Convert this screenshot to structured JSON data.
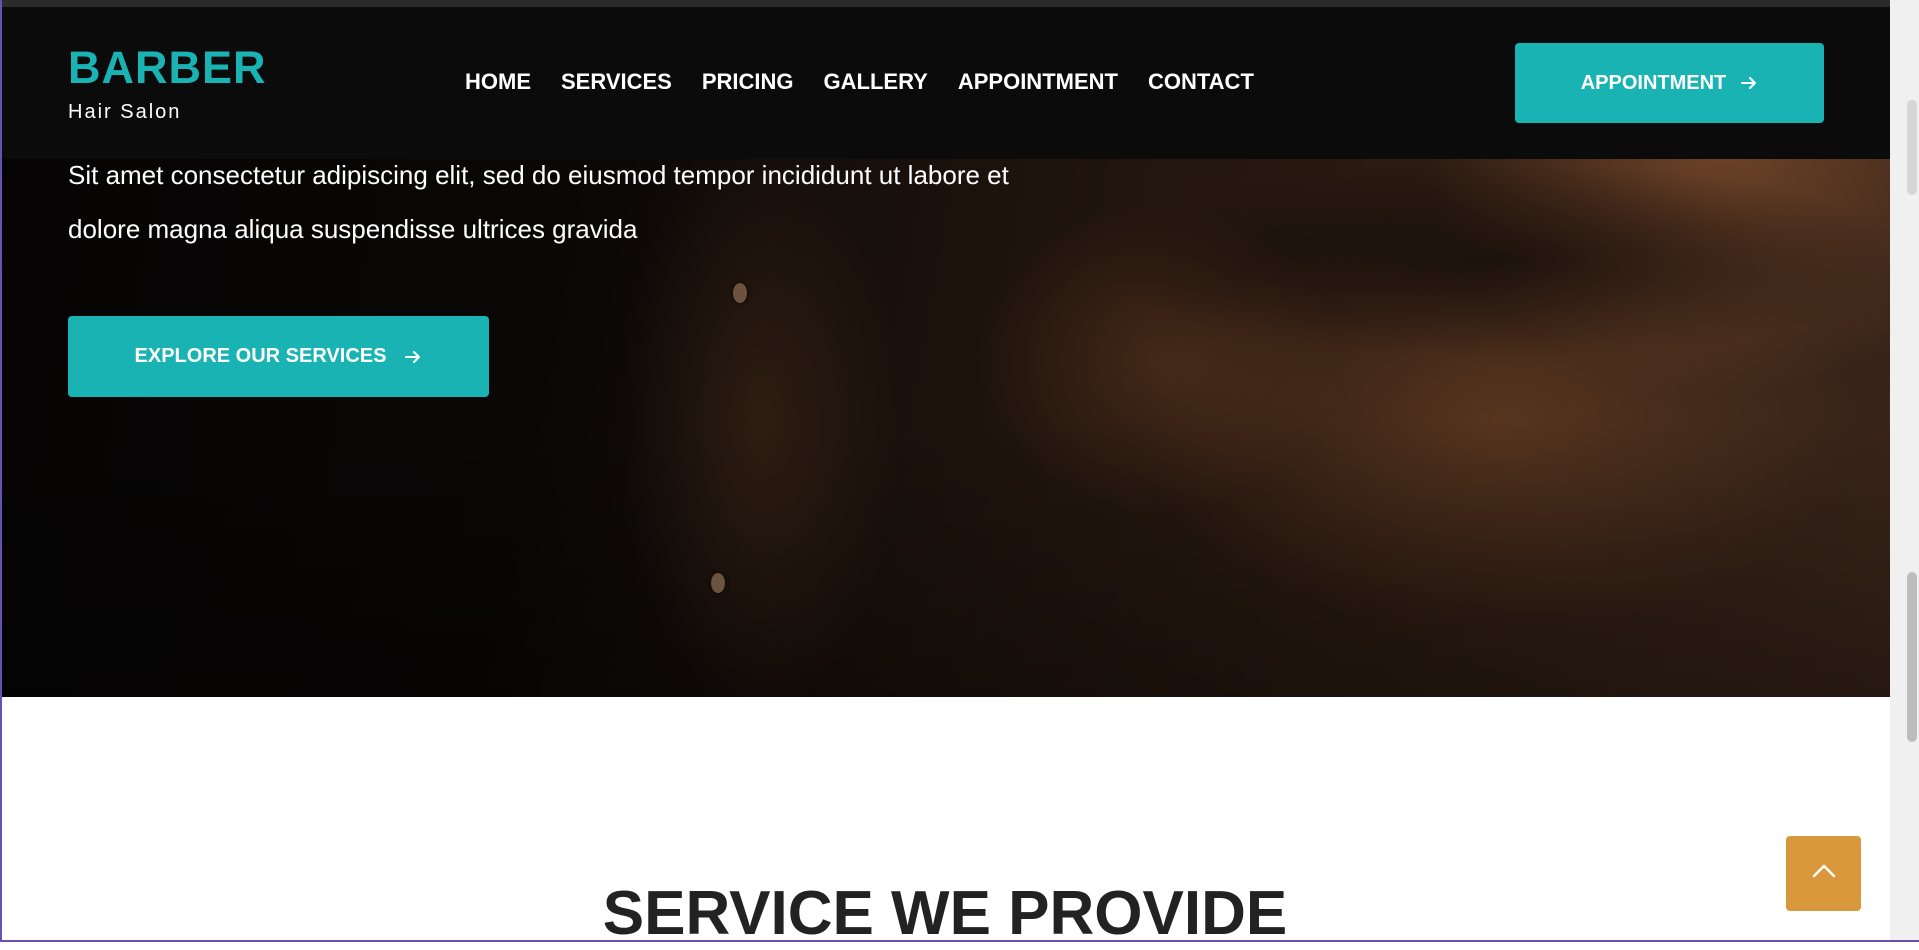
{
  "brand": {
    "name": "BARBER",
    "tagline": "Hair Salon"
  },
  "nav": {
    "items": [
      {
        "label": "HOME"
      },
      {
        "label": "SERVICES"
      },
      {
        "label": "PRICING"
      },
      {
        "label": "GALLERY"
      },
      {
        "label": "APPOINTMENT"
      },
      {
        "label": "CONTACT"
      }
    ]
  },
  "header": {
    "appointment_button": "APPOINTMENT"
  },
  "hero": {
    "line1": "Sit amet consectetur adipiscing elit, sed do eiusmod tempor incididunt ut labore et",
    "line2": "dolore magna aliqua suspendisse ultrices gravida",
    "cta_label": "EXPLORE OUR SERVICES"
  },
  "services": {
    "title": "SERVICE WE PROVIDE"
  },
  "icons": {
    "arrow": "arrow-right-icon",
    "back_to_top": "chevron-up-icon"
  },
  "colors": {
    "accent": "#19b3b4",
    "back_to_top": "#d9983b",
    "header_bg": "#0b0b0b"
  }
}
